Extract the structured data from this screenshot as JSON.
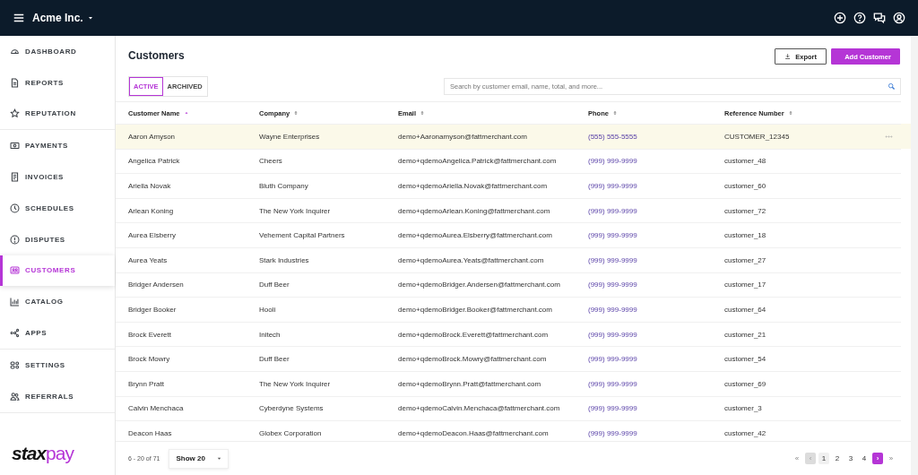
{
  "topbar": {
    "company": "Acme Inc."
  },
  "sidebar": {
    "groups": [
      {
        "items": [
          {
            "label": "DASHBOARD",
            "selected": false
          },
          {
            "label": "REPORTS",
            "selected": false
          },
          {
            "label": "REPUTATION",
            "selected": false
          }
        ]
      },
      {
        "items": [
          {
            "label": "PAYMENTS",
            "selected": false
          },
          {
            "label": "INVOICES",
            "selected": false
          },
          {
            "label": "SCHEDULES",
            "selected": false
          },
          {
            "label": "DISPUTES",
            "selected": false
          },
          {
            "label": "CUSTOMERS",
            "selected": true
          },
          {
            "label": "CATALOG",
            "selected": false
          },
          {
            "label": "APPS",
            "selected": false
          }
        ]
      },
      {
        "items": [
          {
            "label": "SETTINGS",
            "selected": false
          },
          {
            "label": "REFERRALS",
            "selected": false
          }
        ]
      }
    ],
    "logo": {
      "dark_part": "stax",
      "accent_part": "pay"
    }
  },
  "page": {
    "title": "Customers",
    "buttons": [
      {
        "label": "Export",
        "kind": "outline"
      },
      {
        "label": "Add Customer",
        "kind": "primary"
      }
    ],
    "tabs": [
      {
        "label": "ACTIVE",
        "selected": true
      },
      {
        "label": "ARCHIVED",
        "selected": false
      }
    ],
    "search": {
      "placeholder": "Search by customer email, name, total, and more..."
    }
  },
  "table": {
    "columns": [
      {
        "label": "Customer Name",
        "sorted": true
      },
      {
        "label": "Company",
        "sorted": false
      },
      {
        "label": "Email",
        "sorted": false
      },
      {
        "label": "Phone",
        "sorted": false
      },
      {
        "label": "Reference Number",
        "sorted": false
      }
    ],
    "rows": [
      {
        "highlighted": true,
        "cells": [
          "Aaron Amyson",
          "Wayne Enterprises",
          "demo+Aaronamyson@fattmerchant.com",
          "(555) 555-5555",
          "CUSTOMER_12345"
        ]
      },
      {
        "highlighted": false,
        "cells": [
          "Angelica Patrick",
          "Cheers",
          "demo+qdemoAngelica.Patrick@fattmerchant.com",
          "(999) 999-9999",
          "customer_48"
        ]
      },
      {
        "highlighted": false,
        "cells": [
          "Ariella Novak",
          "Bluth Company",
          "demo+qdemoAriella.Novak@fattmerchant.com",
          "(999) 999-9999",
          "customer_60"
        ]
      },
      {
        "highlighted": false,
        "cells": [
          "Arlean Koning",
          "The New York Inquirer",
          "demo+qdemoArlean.Koning@fattmerchant.com",
          "(999) 999-9999",
          "customer_72"
        ]
      },
      {
        "highlighted": false,
        "cells": [
          "Aurea Elsberry",
          "Vehement Capital Partners",
          "demo+qdemoAurea.Elsberry@fattmerchant.com",
          "(999) 999-9999",
          "customer_18"
        ]
      },
      {
        "highlighted": false,
        "cells": [
          "Aurea Yeats",
          "Stark Industries",
          "demo+qdemoAurea.Yeats@fattmerchant.com",
          "(999) 999-9999",
          "customer_27"
        ]
      },
      {
        "highlighted": false,
        "cells": [
          "Bridger Andersen",
          "Duff Beer",
          "demo+qdemoBridger.Andersen@fattmerchant.com",
          "(999) 999-9999",
          "customer_17"
        ]
      },
      {
        "highlighted": false,
        "cells": [
          "Bridger Booker",
          "Hooli",
          "demo+qdemoBridger.Booker@fattmerchant.com",
          "(999) 999-9999",
          "customer_64"
        ]
      },
      {
        "highlighted": false,
        "cells": [
          "Brock Everett",
          "Initech",
          "demo+qdemoBrock.Everett@fattmerchant.com",
          "(999) 999-9999",
          "customer_21"
        ]
      },
      {
        "highlighted": false,
        "cells": [
          "Brock Mowry",
          "Duff Beer",
          "demo+qdemoBrock.Mowry@fattmerchant.com",
          "(999) 999-9999",
          "customer_54"
        ]
      },
      {
        "highlighted": false,
        "cells": [
          "Brynn Pratt",
          "The New York Inquirer",
          "demo+qdemoBrynn.Pratt@fattmerchant.com",
          "(999) 999-9999",
          "customer_69"
        ]
      },
      {
        "highlighted": false,
        "cells": [
          "Calvin Menchaca",
          "Cyberdyne Systems",
          "demo+qdemoCalvin.Menchaca@fattmerchant.com",
          "(999) 999-9999",
          "customer_3"
        ]
      },
      {
        "highlighted": false,
        "cells": [
          "Deacon Haas",
          "Globex Corporation",
          "demo+qdemoDeacon.Haas@fattmerchant.com",
          "(999) 999-9999",
          "customer_42"
        ]
      }
    ]
  },
  "footer": {
    "range": "6 - 20 of 71",
    "page_size": "Show 20",
    "pagination": [
      {
        "label": "«",
        "kind": "first",
        "disabled": false
      },
      {
        "label": "‹",
        "kind": "prev",
        "disabled": true
      },
      {
        "label": "1",
        "kind": "page",
        "selected": true
      },
      {
        "label": "2",
        "kind": "page",
        "selected": false
      },
      {
        "label": "3",
        "kind": "page",
        "selected": false
      },
      {
        "label": "4",
        "kind": "page",
        "selected": false
      },
      {
        "label": "›",
        "kind": "next",
        "disabled": false
      },
      {
        "label": "»",
        "kind": "last",
        "disabled": false
      }
    ]
  }
}
